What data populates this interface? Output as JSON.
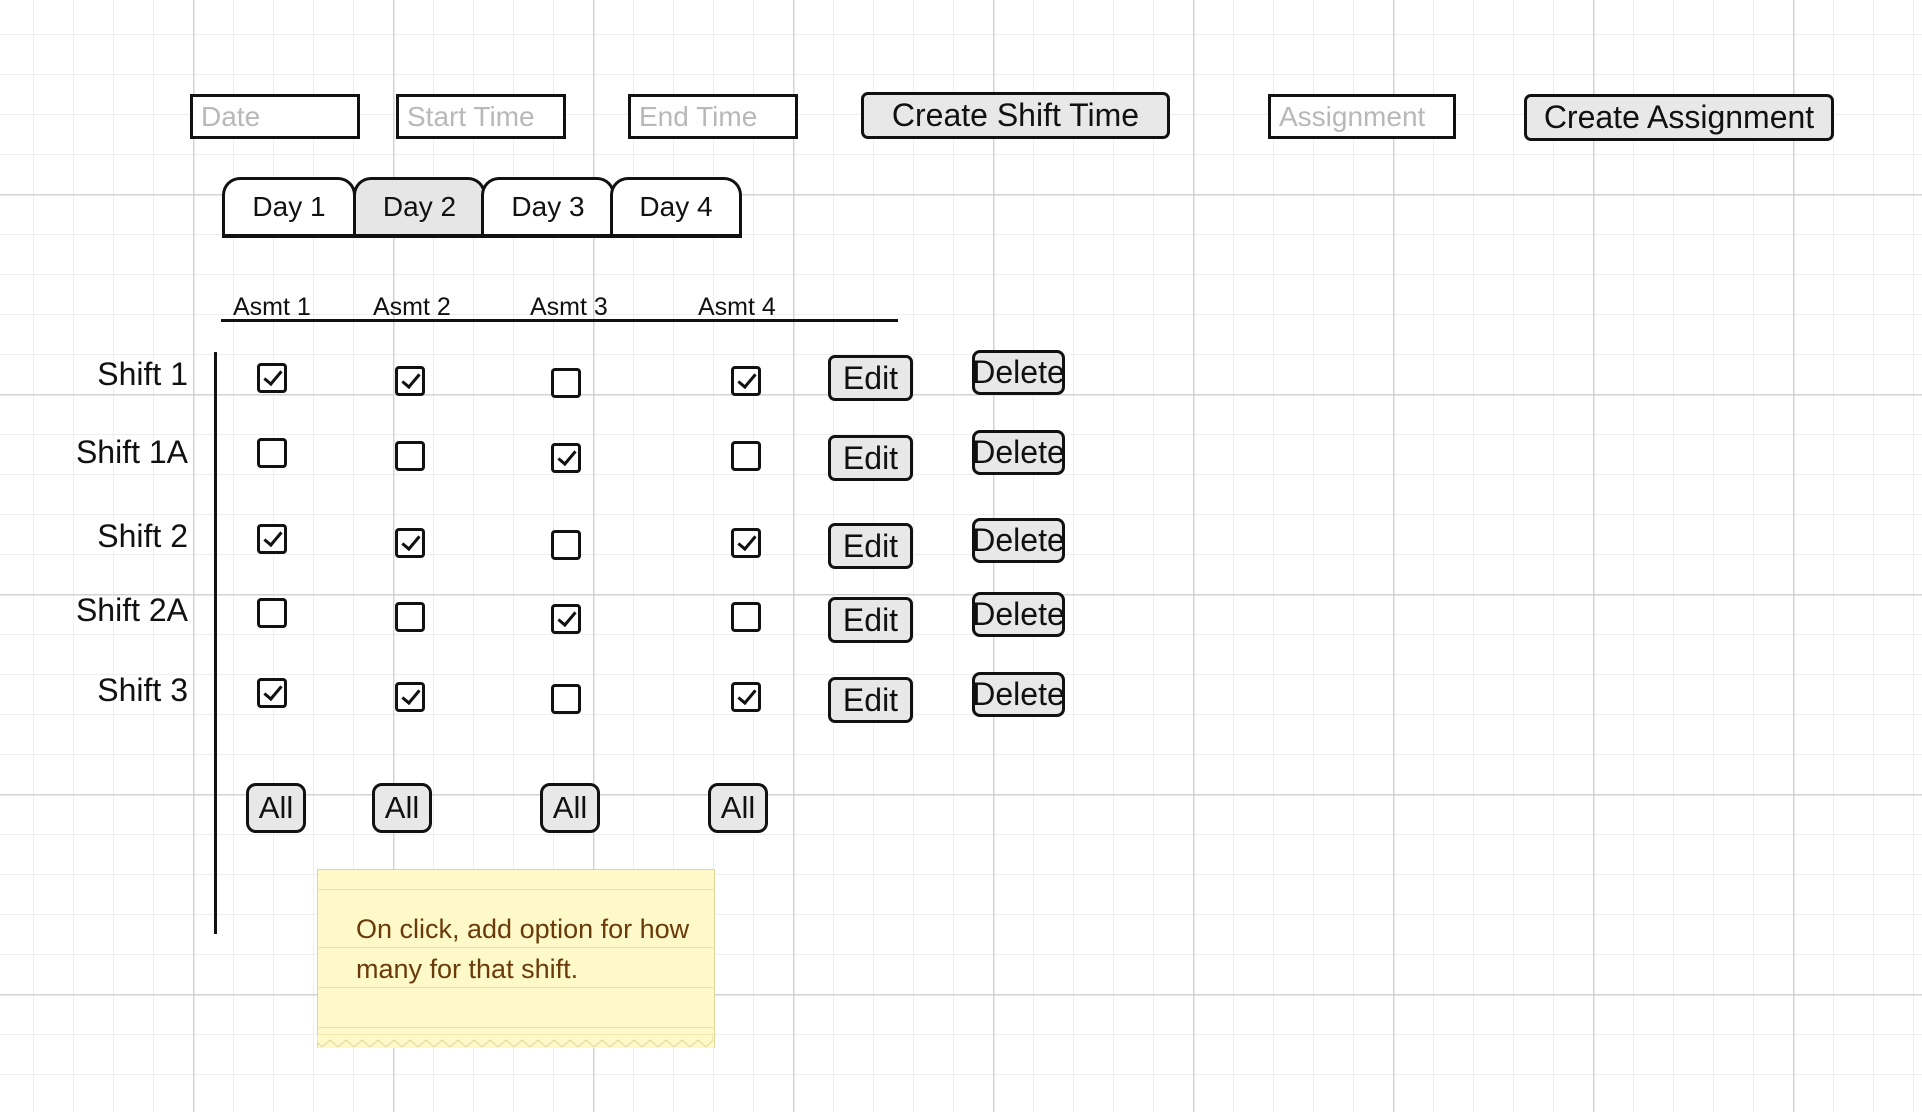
{
  "toolbar": {
    "date_placeholder": "Date",
    "start_time_placeholder": "Start Time",
    "end_time_placeholder": "End Time",
    "create_shift_time_label": "Create Shift Time",
    "assignment_placeholder": "Assignment",
    "create_assignment_label": "Create Assignment"
  },
  "tabs": [
    {
      "label": "Day 1",
      "active": false
    },
    {
      "label": "Day 2",
      "active": true
    },
    {
      "label": "Day 3",
      "active": false
    },
    {
      "label": "Day 4",
      "active": false
    }
  ],
  "columns": [
    "Asmt 1",
    "Asmt 2",
    "Asmt 3",
    "Asmt 4"
  ],
  "rows": [
    {
      "label": "Shift 1",
      "checks": [
        true,
        true,
        false,
        true
      ]
    },
    {
      "label": "Shift 1A",
      "checks": [
        false,
        false,
        true,
        false
      ]
    },
    {
      "label": "Shift 2",
      "checks": [
        true,
        true,
        false,
        true
      ]
    },
    {
      "label": "Shift 2A",
      "checks": [
        false,
        false,
        true,
        false
      ]
    },
    {
      "label": "Shift 3",
      "checks": [
        true,
        true,
        false,
        true
      ]
    }
  ],
  "row_actions": {
    "edit_label": "Edit",
    "delete_label": "Delete"
  },
  "all_label": "All",
  "sticky_note": {
    "text": "On click, add option for how many for that shift."
  }
}
